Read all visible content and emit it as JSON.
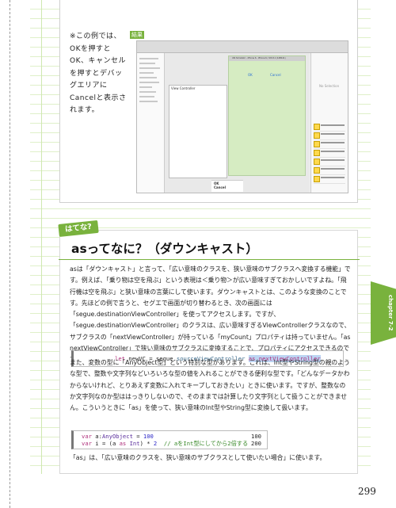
{
  "example": {
    "note": "※この例では、OKを押すとOK、キャンセルを押すとデバッグエリアにCancelと表示されます。",
    "badge": "結果",
    "xcode": {
      "sim_title": "iOS Simulator - iPhone 6 - iPhone 6 / iOS 8.1 (12B411)",
      "sim_ok": "OK",
      "sim_cancel": "Cancel",
      "vc_label": "View Controller",
      "no_selection": "No Selection",
      "debug_ok": "OK",
      "debug_cancel": "Cancel"
    }
  },
  "section": {
    "tag": "はてな?",
    "title": "asってなに？（ダウンキャスト）"
  },
  "paragraphs": {
    "p1": "asは「ダウンキャスト」と言って、「広い意味のクラスを、狭い意味のサブクラスへ変換する機能」です。例えば、「乗り物は空を飛ぶ」という表現は＜乗り物＞が広い意味すぎておかしいですよね。「飛行機は空を飛ぶ」と狭い意味の言葉にして使います。ダウンキャストとは、このような変換のことです。先ほどの例で言うと、セグエで画面が切り替わるとき、次の画面には「segue.destinationViewController」を使ってアクセスします。ですが、「segue.destinationViewController」のクラスは、広い意味すぎるViewControllerクラスなので、サブクラスの「nextViewController」が持っている「myCount」プロパティは持っていません。「as nextViewController」で狭い意味のサブクラスに変換することで、プロパティにアクセスできるのです。",
    "p2": "また、変数の型に「AnyObject型」という特別な型があります。これは、Int型やString型の親のような型で、整数や文字列などいろいろな型の値を入れることができる便利な型です。「どんなデータかわからないけれど、とりあえず変数に入れてキープしておきたい」ときに使います。ですが、整数なのか文字列なのか型ははっきりしないので、そのままでは計算したり文字列として扱うことができません。こういうときに「as」を使って、狭い意味のInt型やString型に変換して扱います。",
    "p3": "「as」は、「広い意味のクラスを、狭い意味のサブクラスとして使いたい場合」に使います。"
  },
  "code1": {
    "kw_let": "let",
    "var_name": " newVC = segue.",
    "member": "sourceViewController",
    "space": " ",
    "as_cast": "as nextViewController"
  },
  "code2": {
    "l1_kw": "var",
    "l1_rest": " a:",
    "l1_type": "AnyObject",
    "l1_eq": " = ",
    "l1_num": "100",
    "l2_kw": "var",
    "l2_rest": " i = (a ",
    "l2_as": "as",
    "l2_sp": " ",
    "l2_type": "Int",
    "l2_mid": ") * ",
    "l2_num": "2",
    "l2_comment": "  // aをInt型にしてから2倍する",
    "r1": "100",
    "r2": "200"
  },
  "chapter_tab": "chapter 7-2",
  "page_number": "299",
  "colors": {
    "accent_green": "#79b23d",
    "paper_line": "#dff0c9",
    "code_highlight": "#bcd4f2"
  }
}
